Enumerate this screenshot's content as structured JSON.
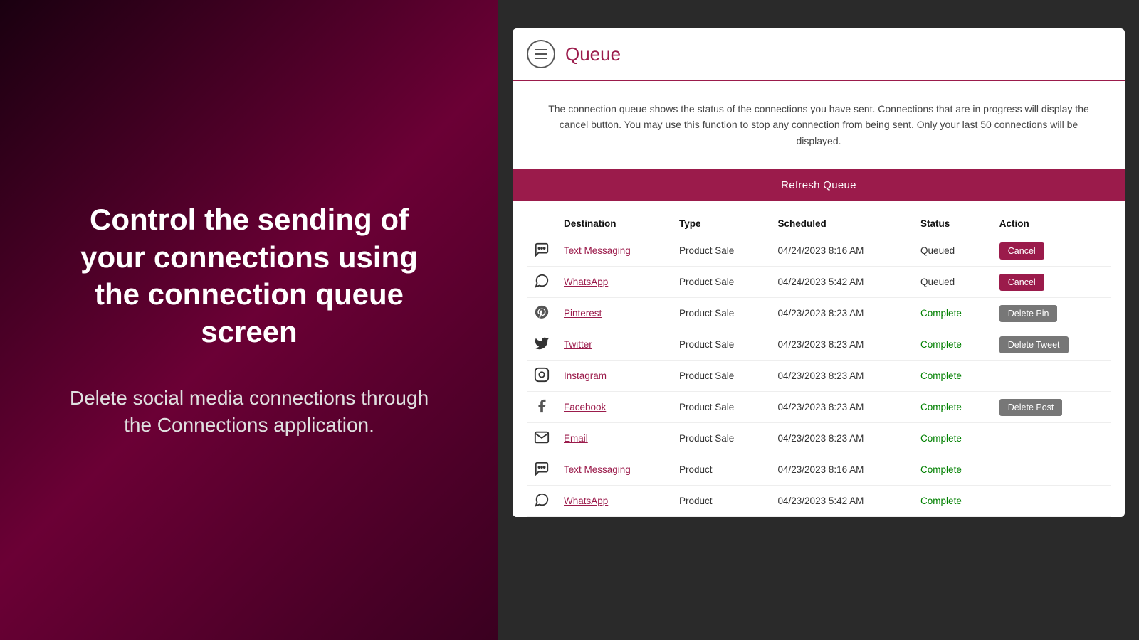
{
  "left": {
    "headline": "Control the sending of your connections using the connection queue screen",
    "subtext": "Delete social media connections through the Connections application."
  },
  "right": {
    "header": {
      "menu_icon_label": "menu",
      "title": "Queue"
    },
    "info": "The connection queue shows the status of the connections you have sent. Connections that are in progress will display the cancel button. You may use this function to stop any connection from being sent. Only your last 50 connections will be displayed.",
    "refresh_button": "Refresh Queue",
    "table": {
      "columns": [
        "",
        "Destination",
        "Type",
        "Scheduled",
        "Status",
        "Action"
      ],
      "rows": [
        {
          "icon": "💬",
          "icon_name": "text-messaging-icon",
          "destination": "Text Messaging",
          "type": "Product Sale",
          "scheduled": "04/24/2023 8:16 AM",
          "status": "Queued",
          "status_class": "queued",
          "action": "Cancel",
          "action_class": "cancel"
        },
        {
          "icon": "🅦",
          "icon_name": "whatsapp-icon",
          "destination": "WhatsApp",
          "type": "Product Sale",
          "scheduled": "04/24/2023 5:42 AM",
          "status": "Queued",
          "status_class": "queued",
          "action": "Cancel",
          "action_class": "cancel"
        },
        {
          "icon": "𝐏",
          "icon_name": "pinterest-icon",
          "destination": "Pinterest",
          "type": "Product Sale",
          "scheduled": "04/23/2023 8:23 AM",
          "status": "Complete",
          "status_class": "complete",
          "action": "Delete Pin",
          "action_class": "delete"
        },
        {
          "icon": "🐦",
          "icon_name": "twitter-icon",
          "destination": "Twitter",
          "type": "Product Sale",
          "scheduled": "04/23/2023 8:23 AM",
          "status": "Complete",
          "status_class": "complete",
          "action": "Delete Tweet",
          "action_class": "delete"
        },
        {
          "icon": "📷",
          "icon_name": "instagram-icon",
          "destination": "Instagram",
          "type": "Product Sale",
          "scheduled": "04/23/2023 8:23 AM",
          "status": "Complete",
          "status_class": "complete",
          "action": "",
          "action_class": ""
        },
        {
          "icon": "𝐅",
          "icon_name": "facebook-icon",
          "destination": "Facebook",
          "type": "Product Sale",
          "scheduled": "04/23/2023 8:23 AM",
          "status": "Complete",
          "status_class": "complete",
          "action": "Delete Post",
          "action_class": "delete"
        },
        {
          "icon": "✉",
          "icon_name": "email-icon",
          "destination": "Email",
          "type": "Product Sale",
          "scheduled": "04/23/2023 8:23 AM",
          "status": "Complete",
          "status_class": "complete",
          "action": "",
          "action_class": ""
        },
        {
          "icon": "💬",
          "icon_name": "text-messaging-icon-2",
          "destination": "Text Messaging",
          "type": "Product",
          "scheduled": "04/23/2023 8:16 AM",
          "status": "Complete",
          "status_class": "complete",
          "action": "",
          "action_class": ""
        },
        {
          "icon": "🅦",
          "icon_name": "whatsapp-icon-2",
          "destination": "WhatsApp",
          "type": "Product",
          "scheduled": "04/23/2023 5:42 AM",
          "status": "Complete",
          "status_class": "complete",
          "action": "",
          "action_class": ""
        }
      ]
    }
  }
}
